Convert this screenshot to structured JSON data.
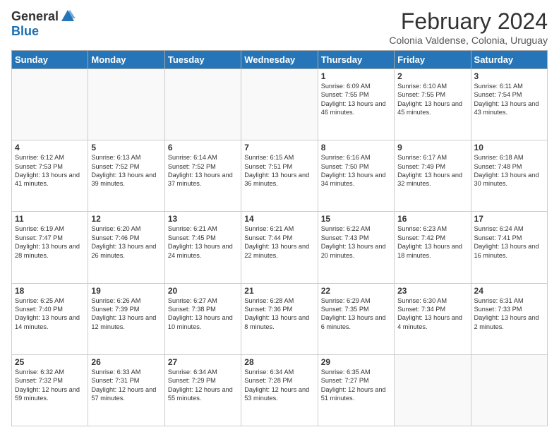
{
  "logo": {
    "general": "General",
    "blue": "Blue"
  },
  "title": "February 2024",
  "subtitle": "Colonia Valdense, Colonia, Uruguay",
  "days_of_week": [
    "Sunday",
    "Monday",
    "Tuesday",
    "Wednesday",
    "Thursday",
    "Friday",
    "Saturday"
  ],
  "weeks": [
    [
      {
        "day": "",
        "info": ""
      },
      {
        "day": "",
        "info": ""
      },
      {
        "day": "",
        "info": ""
      },
      {
        "day": "",
        "info": ""
      },
      {
        "day": "1",
        "info": "Sunrise: 6:09 AM\nSunset: 7:55 PM\nDaylight: 13 hours and 46 minutes."
      },
      {
        "day": "2",
        "info": "Sunrise: 6:10 AM\nSunset: 7:55 PM\nDaylight: 13 hours and 45 minutes."
      },
      {
        "day": "3",
        "info": "Sunrise: 6:11 AM\nSunset: 7:54 PM\nDaylight: 13 hours and 43 minutes."
      }
    ],
    [
      {
        "day": "4",
        "info": "Sunrise: 6:12 AM\nSunset: 7:53 PM\nDaylight: 13 hours and 41 minutes."
      },
      {
        "day": "5",
        "info": "Sunrise: 6:13 AM\nSunset: 7:52 PM\nDaylight: 13 hours and 39 minutes."
      },
      {
        "day": "6",
        "info": "Sunrise: 6:14 AM\nSunset: 7:52 PM\nDaylight: 13 hours and 37 minutes."
      },
      {
        "day": "7",
        "info": "Sunrise: 6:15 AM\nSunset: 7:51 PM\nDaylight: 13 hours and 36 minutes."
      },
      {
        "day": "8",
        "info": "Sunrise: 6:16 AM\nSunset: 7:50 PM\nDaylight: 13 hours and 34 minutes."
      },
      {
        "day": "9",
        "info": "Sunrise: 6:17 AM\nSunset: 7:49 PM\nDaylight: 13 hours and 32 minutes."
      },
      {
        "day": "10",
        "info": "Sunrise: 6:18 AM\nSunset: 7:48 PM\nDaylight: 13 hours and 30 minutes."
      }
    ],
    [
      {
        "day": "11",
        "info": "Sunrise: 6:19 AM\nSunset: 7:47 PM\nDaylight: 13 hours and 28 minutes."
      },
      {
        "day": "12",
        "info": "Sunrise: 6:20 AM\nSunset: 7:46 PM\nDaylight: 13 hours and 26 minutes."
      },
      {
        "day": "13",
        "info": "Sunrise: 6:21 AM\nSunset: 7:45 PM\nDaylight: 13 hours and 24 minutes."
      },
      {
        "day": "14",
        "info": "Sunrise: 6:21 AM\nSunset: 7:44 PM\nDaylight: 13 hours and 22 minutes."
      },
      {
        "day": "15",
        "info": "Sunrise: 6:22 AM\nSunset: 7:43 PM\nDaylight: 13 hours and 20 minutes."
      },
      {
        "day": "16",
        "info": "Sunrise: 6:23 AM\nSunset: 7:42 PM\nDaylight: 13 hours and 18 minutes."
      },
      {
        "day": "17",
        "info": "Sunrise: 6:24 AM\nSunset: 7:41 PM\nDaylight: 13 hours and 16 minutes."
      }
    ],
    [
      {
        "day": "18",
        "info": "Sunrise: 6:25 AM\nSunset: 7:40 PM\nDaylight: 13 hours and 14 minutes."
      },
      {
        "day": "19",
        "info": "Sunrise: 6:26 AM\nSunset: 7:39 PM\nDaylight: 13 hours and 12 minutes."
      },
      {
        "day": "20",
        "info": "Sunrise: 6:27 AM\nSunset: 7:38 PM\nDaylight: 13 hours and 10 minutes."
      },
      {
        "day": "21",
        "info": "Sunrise: 6:28 AM\nSunset: 7:36 PM\nDaylight: 13 hours and 8 minutes."
      },
      {
        "day": "22",
        "info": "Sunrise: 6:29 AM\nSunset: 7:35 PM\nDaylight: 13 hours and 6 minutes."
      },
      {
        "day": "23",
        "info": "Sunrise: 6:30 AM\nSunset: 7:34 PM\nDaylight: 13 hours and 4 minutes."
      },
      {
        "day": "24",
        "info": "Sunrise: 6:31 AM\nSunset: 7:33 PM\nDaylight: 13 hours and 2 minutes."
      }
    ],
    [
      {
        "day": "25",
        "info": "Sunrise: 6:32 AM\nSunset: 7:32 PM\nDaylight: 12 hours and 59 minutes."
      },
      {
        "day": "26",
        "info": "Sunrise: 6:33 AM\nSunset: 7:31 PM\nDaylight: 12 hours and 57 minutes."
      },
      {
        "day": "27",
        "info": "Sunrise: 6:34 AM\nSunset: 7:29 PM\nDaylight: 12 hours and 55 minutes."
      },
      {
        "day": "28",
        "info": "Sunrise: 6:34 AM\nSunset: 7:28 PM\nDaylight: 12 hours and 53 minutes."
      },
      {
        "day": "29",
        "info": "Sunrise: 6:35 AM\nSunset: 7:27 PM\nDaylight: 12 hours and 51 minutes."
      },
      {
        "day": "",
        "info": ""
      },
      {
        "day": "",
        "info": ""
      }
    ]
  ]
}
